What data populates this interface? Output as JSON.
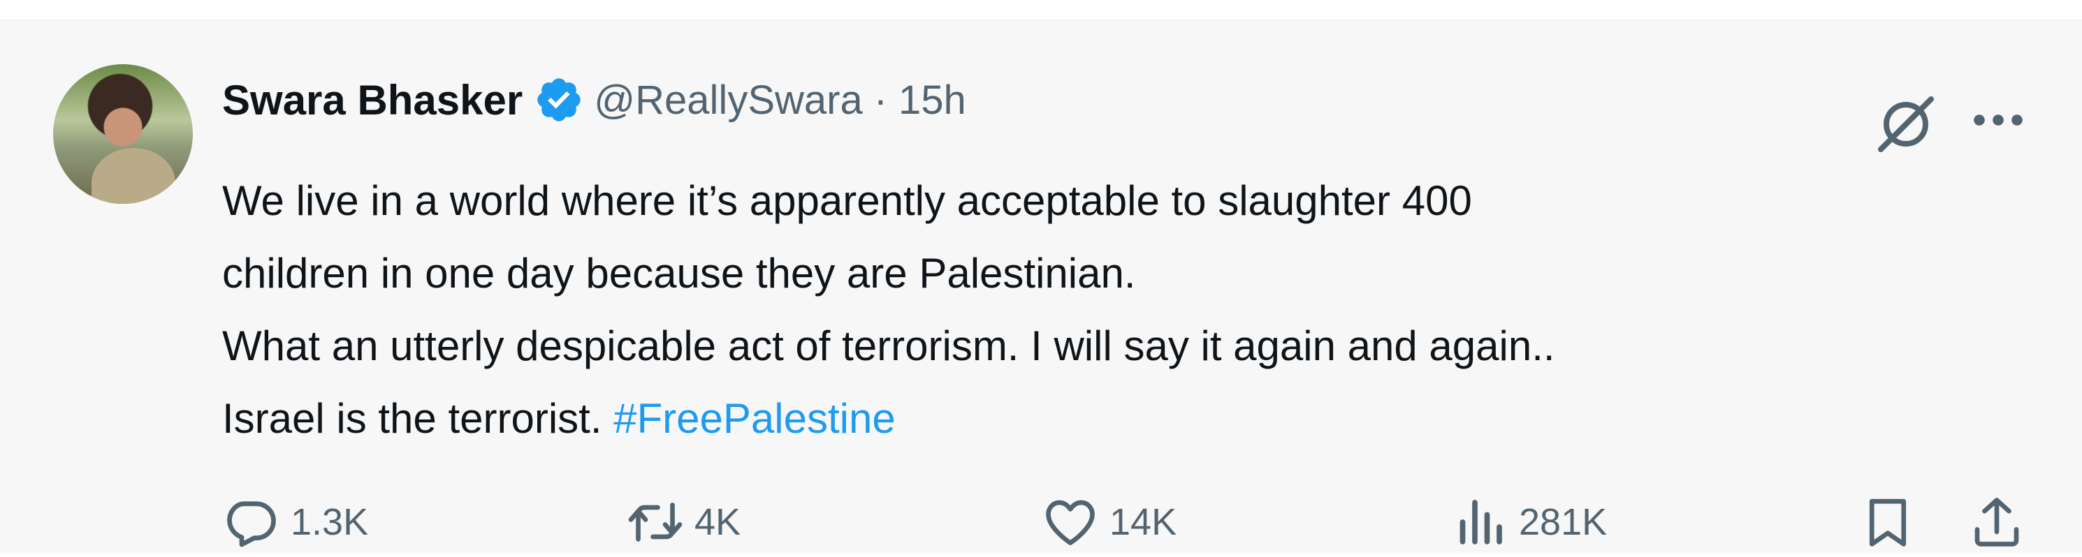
{
  "author": {
    "name": "Swara Bhasker",
    "handle": "@ReallySwara",
    "separator": "·",
    "time": "15h"
  },
  "icons": {
    "verified": "verified-badge-icon",
    "grok": "grok-icon",
    "more": "more-options-icon",
    "reply": "reply-icon",
    "repost": "repost-icon",
    "like": "heart-icon",
    "views": "views-chart-icon",
    "bookmark": "bookmark-icon",
    "share": "share-icon"
  },
  "colors": {
    "accent": "#1d9bf0",
    "muted": "#536471",
    "text": "#0f1419"
  },
  "tweet": {
    "line1": "We live in a world where it’s apparently acceptable to slaughter 400",
    "line2": "children in one day because they are Palestinian.",
    "line3": "What an utterly despicable act of terrorism. I will say it again and again..",
    "line4": "Israel is the terrorist. ",
    "hashtag": "#FreePalestine"
  },
  "stats": {
    "replies": "1.3K",
    "reposts": "4K",
    "likes": "14K",
    "views": "281K"
  }
}
